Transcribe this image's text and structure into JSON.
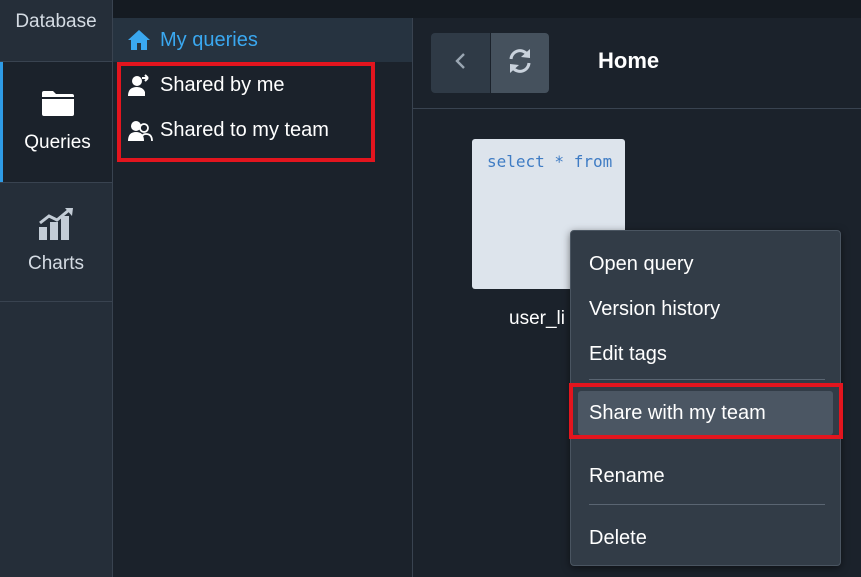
{
  "rail": {
    "items": [
      {
        "label": "Database",
        "icon": "database-icon"
      },
      {
        "label": "Queries",
        "icon": "folder-icon"
      },
      {
        "label": "Charts",
        "icon": "chart-icon"
      }
    ]
  },
  "tree": {
    "items": [
      {
        "label": "My queries",
        "icon": "home-icon"
      },
      {
        "label": "Shared by me",
        "icon": "user-share-icon"
      },
      {
        "label": "Shared to my team",
        "icon": "team-icon"
      }
    ]
  },
  "toolbar": {
    "back_icon": "chevron-left-icon",
    "refresh_icon": "refresh-icon",
    "breadcrumb": "Home"
  },
  "card": {
    "preview": "select * from",
    "name": "user_li"
  },
  "context_menu": {
    "items": [
      {
        "label": "Open query"
      },
      {
        "label": "Version history"
      },
      {
        "label": "Edit tags"
      },
      {
        "label": "Share with my team"
      },
      {
        "label": "Rename"
      },
      {
        "label": "Delete"
      }
    ]
  },
  "colors": {
    "accent": "#3aa8f0",
    "highlight": "#e3151e",
    "background": "#1b222b"
  }
}
